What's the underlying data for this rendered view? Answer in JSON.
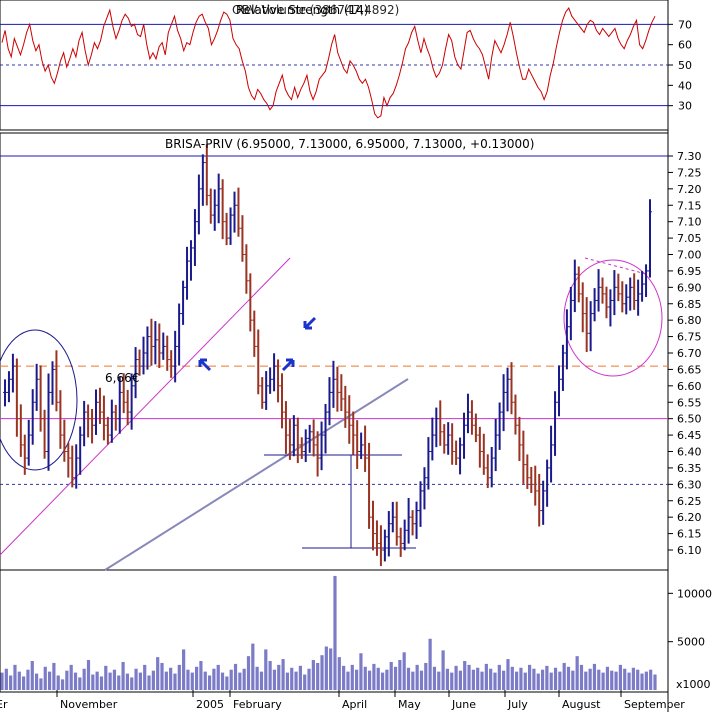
{
  "chart_data": [
    {
      "type": "line",
      "panel": "rsi",
      "title": "Relative Strength (14)",
      "title_overlay": "OBV Volume (386747,4892)",
      "ylim": [
        20,
        80
      ],
      "yticks": [
        30,
        40,
        50,
        60,
        70
      ],
      "reference_lines": [
        30,
        50,
        70
      ],
      "series": [
        {
          "color": "#cc0000",
          "values": [
            61,
            67,
            58,
            54,
            63,
            59,
            55,
            60,
            66,
            70,
            62,
            57,
            60,
            52,
            47,
            50,
            44,
            41,
            46,
            52,
            56,
            49,
            53,
            58,
            54,
            62,
            66,
            57,
            50,
            55,
            61,
            58,
            62,
            69,
            73,
            77,
            69,
            63,
            67,
            72,
            75,
            73,
            69,
            70,
            65,
            64,
            70,
            60,
            53,
            56,
            53,
            59,
            61,
            55,
            66,
            70,
            74,
            67,
            63,
            57,
            61,
            60,
            66,
            71,
            74,
            75,
            71,
            68,
            60,
            63,
            67,
            72,
            76,
            75,
            72,
            63,
            60,
            58,
            52,
            47,
            39,
            35,
            33,
            38,
            36,
            33,
            31,
            28,
            30,
            37,
            41,
            45,
            38,
            35,
            33,
            39,
            34,
            38,
            41,
            45,
            37,
            33,
            37,
            43,
            45,
            47,
            53,
            60,
            65,
            56,
            52,
            48,
            46,
            52,
            50,
            47,
            43,
            41,
            43,
            39,
            33,
            26,
            24,
            25,
            34,
            30,
            34,
            36,
            40,
            45,
            51,
            58,
            61,
            66,
            69,
            62,
            56,
            63,
            58,
            54,
            48,
            44,
            46,
            50,
            58,
            65,
            62,
            54,
            50,
            48,
            57,
            66,
            67,
            63,
            60,
            58,
            55,
            49,
            43,
            54,
            62,
            59,
            56,
            60,
            65,
            71,
            64,
            56,
            49,
            43,
            43,
            48,
            45,
            42,
            39,
            37,
            33,
            37,
            45,
            51,
            59,
            66,
            72,
            76,
            78,
            74,
            72,
            70,
            68,
            66,
            70,
            72,
            71,
            67,
            65,
            68,
            66,
            64,
            66,
            68,
            63,
            60,
            58,
            62,
            65,
            69,
            72,
            60,
            58,
            62,
            67,
            71,
            74
          ]
        }
      ]
    },
    {
      "type": "line",
      "panel": "price",
      "title": "BRISA-PRIV (6.95000, 7.13000, 6.95000, 7.13000, +0.13000)",
      "ylim": [
        6.05,
        7.35
      ],
      "yticks": [
        6.1,
        6.15,
        6.2,
        6.25,
        6.3,
        6.35,
        6.4,
        6.45,
        6.5,
        6.55,
        6.6,
        6.65,
        6.7,
        6.75,
        6.8,
        6.85,
        6.9,
        6.95,
        7.0,
        7.05,
        7.1,
        7.15,
        7.2,
        7.25,
        7.3
      ],
      "annotation": "6,66€",
      "horizontal_levels": [
        {
          "value": 7.3,
          "style": "solid",
          "color": "#1a1ab0"
        },
        {
          "value": 6.66,
          "style": "dashed",
          "color": "#ee7733"
        },
        {
          "value": 6.5,
          "style": "solid",
          "color": "#cc33cc"
        },
        {
          "value": 6.3,
          "style": "dotted",
          "color": "#3333aa"
        }
      ],
      "series": [
        {
          "color": "#1a1a8c",
          "values": [
            6.58,
            6.62,
            6.66,
            6.5,
            6.42,
            6.38,
            6.45,
            6.55,
            6.62,
            6.5,
            6.4,
            6.58,
            6.65,
            6.55,
            6.45,
            6.4,
            6.38,
            6.32,
            6.38,
            6.45,
            6.52,
            6.5,
            6.48,
            6.55,
            6.52,
            6.48,
            6.45,
            6.52,
            6.5,
            6.58,
            6.55,
            6.52,
            6.6,
            6.68,
            6.66,
            6.7,
            6.75,
            6.72,
            6.74,
            6.7,
            6.72,
            6.68,
            6.66,
            6.72,
            6.82,
            6.9,
            6.98,
            7.02,
            7.1,
            7.2,
            7.28,
            7.18,
            7.12,
            7.15,
            7.2,
            7.1,
            7.05,
            7.12,
            7.15,
            7.08,
            7.0,
            6.92,
            6.8,
            6.72,
            6.6,
            6.55,
            6.6,
            6.62,
            6.66,
            6.6,
            6.52,
            6.45,
            6.42,
            6.48,
            6.42,
            6.4,
            6.44,
            6.46,
            6.42,
            6.38,
            6.45,
            6.52,
            6.58,
            6.62,
            6.58,
            6.56,
            6.52,
            6.48,
            6.45,
            6.4,
            6.42,
            6.38,
            6.2,
            6.15,
            6.12,
            6.1,
            6.14,
            6.18,
            6.2,
            6.14,
            6.12,
            6.16,
            6.2,
            6.18,
            6.22,
            6.28,
            6.32,
            6.4,
            6.45,
            6.5,
            6.46,
            6.42,
            6.45,
            6.4,
            6.38,
            6.42,
            6.48,
            6.52,
            6.48,
            6.45,
            6.4,
            6.35,
            6.32,
            6.38,
            6.45,
            6.52,
            6.58,
            6.62,
            6.55,
            6.48,
            6.42,
            6.36,
            6.32,
            6.3,
            6.28,
            6.22,
            6.28,
            6.35,
            6.42,
            6.55,
            6.62,
            6.7,
            6.78,
            6.86,
            6.94,
            6.88,
            6.82,
            6.76,
            6.82,
            6.86,
            6.9,
            6.88,
            6.84,
            6.86,
            6.9,
            6.88,
            6.85,
            6.87,
            6.9,
            6.86,
            6.88,
            6.91,
            6.95,
            7.13
          ]
        }
      ]
    },
    {
      "type": "bar",
      "panel": "volume",
      "ylim": [
        0,
        12000
      ],
      "yticks": [
        5000,
        10000
      ],
      "unit_label": "x1000",
      "series": [
        {
          "color": "#7b7bc8",
          "values": [
            1800,
            2200,
            1500,
            2600,
            1900,
            1400,
            2100,
            3000,
            1700,
            1200,
            2400,
            1900,
            2800,
            1500,
            1100,
            2000,
            2600,
            1800,
            1300,
            2200,
            3100,
            1600,
            1900,
            1400,
            2500,
            1800,
            2100,
            1500,
            2900,
            1700,
            1300,
            2200,
            1800,
            2600,
            1500,
            2000,
            3400,
            2800,
            1900,
            2300,
            1700,
            2600,
            4200,
            2100,
            1800,
            2400,
            3000,
            1900,
            1500,
            2200,
            2600,
            1800,
            1400,
            2100,
            2700,
            1800,
            2200,
            3500,
            4800,
            2400,
            1900,
            4200,
            3000,
            2100,
            2600,
            3200,
            1800,
            2300,
            1900,
            2500,
            1600,
            2200,
            3100,
            2800,
            3600,
            4500,
            4300,
            11800,
            3400,
            2500,
            1900,
            2600,
            2100,
            3800,
            2400,
            2000,
            2700,
            2300,
            1800,
            2100,
            2900,
            2400,
            3100,
            3900,
            2300,
            1900,
            2600,
            2000,
            2800,
            5300,
            2400,
            1900,
            4100,
            2200,
            1800,
            2500,
            2000,
            3000,
            2600,
            2100,
            2300,
            1900,
            2700,
            2200,
            1800,
            2600,
            2000,
            3200,
            2400,
            1900,
            2300,
            1800,
            2600,
            2200,
            1700,
            2100,
            2500,
            1800,
            2300,
            1900,
            2800,
            2400,
            2000,
            3500,
            2600,
            1900,
            2200,
            2700,
            2100,
            1800,
            2400,
            2000,
            1900,
            2600,
            2200,
            1800,
            2300,
            2100,
            1700,
            1900,
            2100,
            1600
          ]
        }
      ]
    },
    {
      "type": "axis",
      "panel": "time",
      "x_labels": [
        "November",
        "2005",
        "February",
        "April",
        "May",
        "June",
        "July",
        "August",
        "September"
      ],
      "x_label_left_edge": "Er"
    }
  ]
}
